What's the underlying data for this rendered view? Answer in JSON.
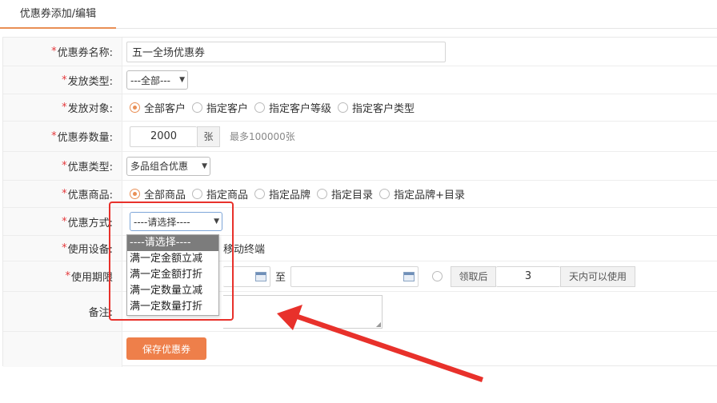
{
  "tab": {
    "label": "优惠券添加/编辑"
  },
  "form": {
    "name": {
      "label": "优惠券名称:",
      "value": "五一全场优惠券"
    },
    "issue_type": {
      "label": "发放类型:",
      "selected": "---全部---"
    },
    "target": {
      "label": "发放对象:",
      "options": [
        "全部客户",
        "指定客户",
        "指定客户等级",
        "指定客户类型"
      ],
      "selected_index": 0
    },
    "quantity": {
      "label": "优惠券数量:",
      "value": "2000",
      "unit": "张",
      "hint": "最多100000张"
    },
    "discount_type": {
      "label": "优惠类型:",
      "selected": "多品组合优惠"
    },
    "goods": {
      "label": "优惠商品:",
      "options": [
        "全部商品",
        "指定商品",
        "指定品牌",
        "指定目录",
        "指定品牌+目录"
      ],
      "selected_index": 0
    },
    "method": {
      "label": "优惠方式:",
      "selected": "----请选择----",
      "options": [
        "----请选择----",
        "满一定金额立减",
        "满一定金额打折",
        "满一定数量立减",
        "满一定数量打折"
      ]
    },
    "device": {
      "label": "使用设备:",
      "partial_text": "移动终端"
    },
    "period": {
      "label": "使用期限",
      "to": "至",
      "prefix": "领取后",
      "days": "3",
      "suffix": "天内可以使用"
    },
    "remark": {
      "label": "备注:"
    },
    "save_label": "保存优惠券"
  },
  "colors": {
    "accent": "#ee7f4a",
    "required": "#e4393c",
    "highlight_box": "#e8312b"
  }
}
